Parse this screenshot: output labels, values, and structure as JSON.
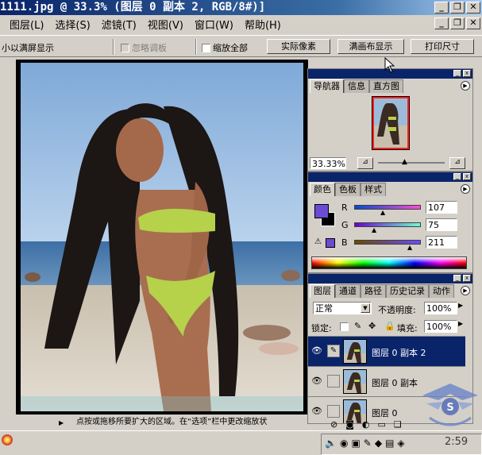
{
  "window": {
    "title": "1111.jpg @ 33.3% (图层 0 副本 2, RGB/8#)]",
    "btn_min": "_",
    "btn_max": "❐",
    "btn_close": "✕"
  },
  "menu": {
    "items": [
      "图层(L)",
      "选择(S)",
      "滤镜(T)",
      "视图(V)",
      "窗口(W)",
      "帮助(H)"
    ]
  },
  "options": {
    "fit_screen": "小以满屏显示",
    "ignore_palettes": "忽略调板",
    "zoom_all": "缩放全部",
    "actual_pixels": "实际像素",
    "fit_on_screen": "满画布显示",
    "print_size": "打印尺寸"
  },
  "status": {
    "text": "点按或拖移所要扩大的区域。在“选项”栏中更改缩放状"
  },
  "navigator": {
    "tabs": [
      "导航器",
      "信息",
      "直方图"
    ],
    "zoom": "33.33%"
  },
  "color": {
    "tabs": [
      "颜色",
      "色板",
      "样式"
    ],
    "channels": [
      {
        "label": "R",
        "value": "107"
      },
      {
        "label": "G",
        "value": "75"
      },
      {
        "label": "B",
        "value": "211"
      }
    ],
    "fg": "#6b4bd3",
    "bg": "#000000"
  },
  "layers": {
    "tabs": [
      "图层",
      "通道",
      "路径",
      "历史记录",
      "动作"
    ],
    "blend_mode": "正常",
    "opacity_label": "不透明度:",
    "opacity": "100%",
    "lock_label": "锁定:",
    "fill_label": "填充:",
    "fill": "100%",
    "rows": [
      {
        "name": "图层 0 副本 2",
        "selected": true
      },
      {
        "name": "图层 0 副本",
        "selected": false
      },
      {
        "name": "图层 0",
        "selected": false
      }
    ]
  },
  "taskbar": {
    "clock": "2:59"
  }
}
